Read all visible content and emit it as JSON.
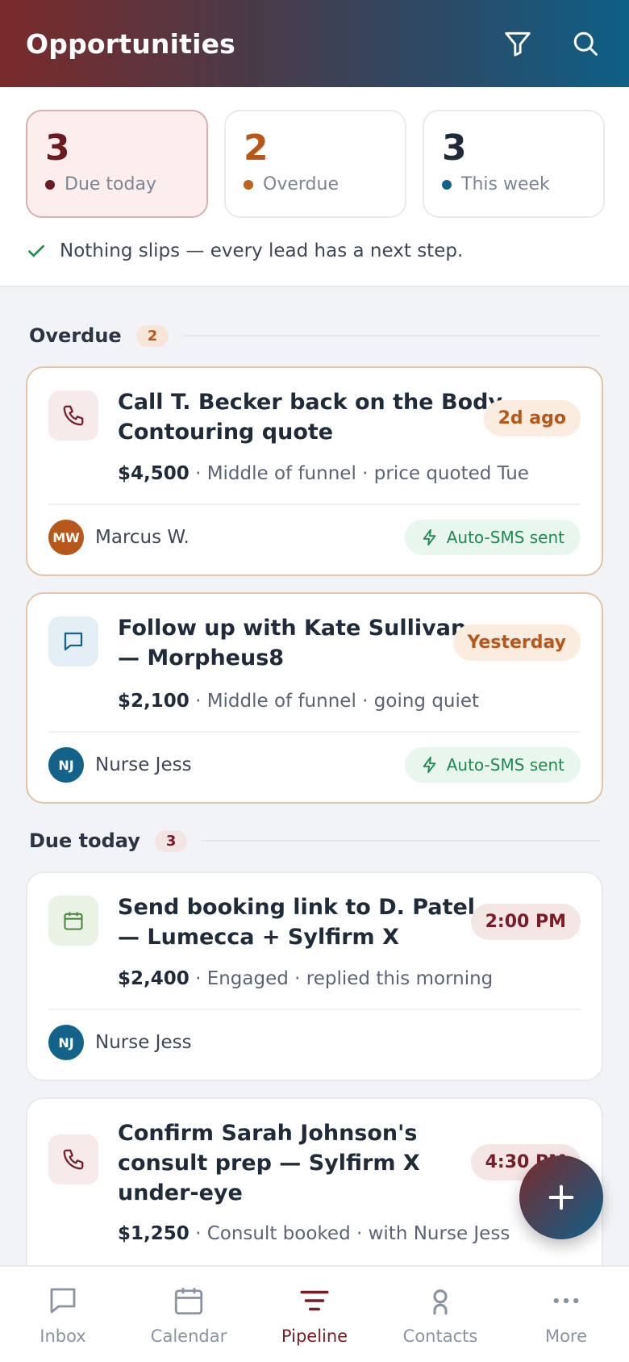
{
  "header": {
    "title": "Opportunities",
    "filter_icon": "filter-icon",
    "search_icon": "search-icon"
  },
  "stats": [
    {
      "value": "3",
      "label": "Due today",
      "color": "#6b1b1f",
      "dot": "#6b1b1f"
    },
    {
      "value": "2",
      "label": "Overdue",
      "color": "#b8571a",
      "dot": "#c0601f"
    },
    {
      "value": "3",
      "label": "This week",
      "color": "#1f2a3a",
      "dot": "#13628a"
    }
  ],
  "tagline": "Nothing slips — every lead has a next step.",
  "sections": {
    "overdue": {
      "title": "Overdue",
      "count": "2"
    },
    "due_today": {
      "title": "Due today",
      "count": "3"
    }
  },
  "cards": [
    {
      "title_line1": "Call T. Becker back on the Body",
      "title_line2": "Contouring quote",
      "pill": "2d ago",
      "amount": "$4,500",
      "meta": " · Middle of funnel · price quoted Tue",
      "owner_initials": "MW",
      "owner": "Marcus W.",
      "auto_sms": "Auto-SMS sent",
      "icon": "phone-icon"
    },
    {
      "title_line1": "Follow up with Kate Sullivan",
      "title_line2": "— Morpheus8",
      "pill": "Yesterday",
      "amount": "$2,100",
      "meta": " · Middle of funnel · going quiet",
      "owner_initials": "NJ",
      "owner": "Nurse Jess",
      "auto_sms": "Auto-SMS sent",
      "icon": "message-icon"
    },
    {
      "title_line1": "Send booking link to D. Patel",
      "title_line2": "— Lumecca + Sylfirm X",
      "pill": "2:00 PM",
      "amount": "$2,400",
      "meta": " · Engaged · replied this morning",
      "owner_initials": "NJ",
      "owner": "Nurse Jess",
      "icon": "calendar-icon"
    },
    {
      "title_line1": "Confirm Sarah Johnson's",
      "title_line2": "consult prep — Sylfirm X",
      "title_line3": "under-eye",
      "pill": "4:30 PM",
      "amount": "$1,250",
      "meta": " · Consult booked · with Nurse Jess",
      "icon": "phone-icon"
    }
  ],
  "fab": {
    "icon": "plus-icon"
  },
  "nav": [
    {
      "label": "Inbox",
      "icon": "inbox-icon"
    },
    {
      "label": "Calendar",
      "icon": "calendar-icon"
    },
    {
      "label": "Pipeline",
      "icon": "pipeline-icon",
      "active": true
    },
    {
      "label": "Contacts",
      "icon": "contacts-icon"
    },
    {
      "label": "More",
      "icon": "more-icon"
    }
  ]
}
